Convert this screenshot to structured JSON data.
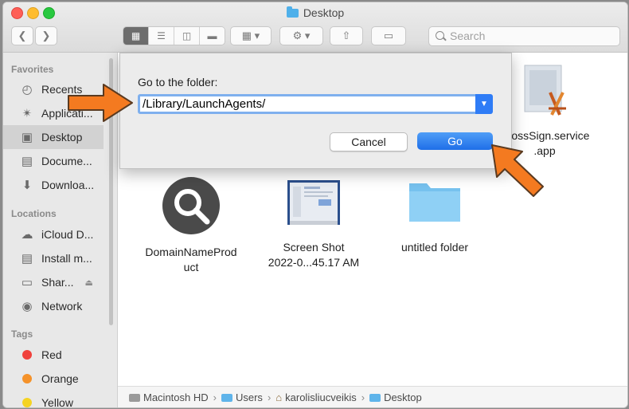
{
  "window": {
    "title": "Desktop"
  },
  "toolbar": {
    "search_placeholder": "Search",
    "view_modes": [
      "icon-view",
      "list-view",
      "column-view",
      "gallery-view"
    ]
  },
  "sidebar": {
    "favorites_header": "Favorites",
    "favorites": [
      {
        "label": "Recents",
        "icon": "clock-icon"
      },
      {
        "label": "Applicati...",
        "icon": "applications-icon"
      },
      {
        "label": "Desktop",
        "icon": "desktop-icon",
        "selected": true
      },
      {
        "label": "Docume...",
        "icon": "document-icon"
      },
      {
        "label": "Downloa...",
        "icon": "download-icon"
      }
    ],
    "locations_header": "Locations",
    "locations": [
      {
        "label": "iCloud D...",
        "icon": "cloud-icon"
      },
      {
        "label": "Install m...",
        "icon": "disk-icon"
      },
      {
        "label": "Shar...",
        "icon": "display-icon"
      },
      {
        "label": "Network",
        "icon": "globe-icon"
      }
    ],
    "tags_header": "Tags",
    "tags": [
      {
        "label": "Red",
        "color": "#f0413c"
      },
      {
        "label": "Orange",
        "color": "#f5922a"
      },
      {
        "label": "Yellow",
        "color": "#f5d323"
      }
    ]
  },
  "dialog": {
    "label": "Go to the folder:",
    "path_value": "/Library/LaunchAgents/",
    "cancel_label": "Cancel",
    "go_label": "Go"
  },
  "files": {
    "crosssign_line1": "CrossSign.service",
    "crosssign_line2": ".app",
    "domain_line1": "DomainNameProd",
    "domain_line2": "uct",
    "screenshot_line1": "Screen Shot",
    "screenshot_line2": "2022-0...45.17 AM",
    "folder_name": "untitled folder"
  },
  "pathbar": {
    "segments": [
      "Macintosh HD",
      "Users",
      "karolisliucveikis",
      "Desktop"
    ]
  },
  "colors": {
    "accent": "#2f7cf6",
    "highlight_arrow": "#f47a20"
  }
}
